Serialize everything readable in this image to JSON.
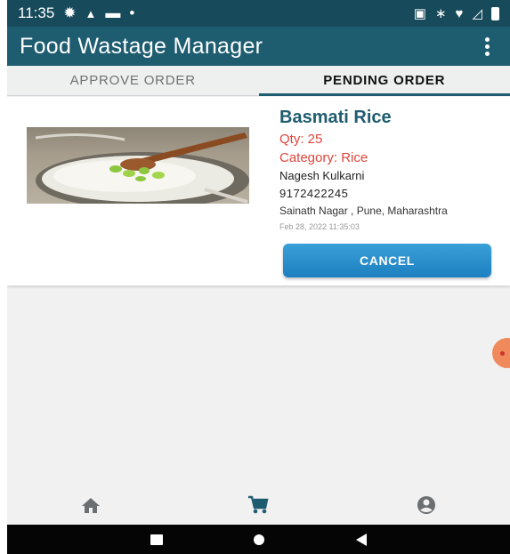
{
  "status_bar": {
    "time": "11:35",
    "icons": [
      "settings-icon",
      "warning-icon",
      "video-icon",
      "dot-icon",
      "nfc-icon",
      "bluetooth-icon",
      "wifi-icon",
      "signal-icon",
      "battery-icon"
    ]
  },
  "app_bar": {
    "title": "Food Wastage Manager",
    "menu_icon": "more-vert-icon"
  },
  "tabs": [
    {
      "label": "APPROVE ORDER",
      "selected": false
    },
    {
      "label": "PENDING ORDER",
      "selected": true
    }
  ],
  "order": {
    "name": "Basmati Rice",
    "qty": "Qty: 25",
    "category": "Category: Rice",
    "donor": "Nagesh Kulkarni",
    "phone": "9172422245",
    "address": "Sainath Nagar , Pune, Maharashtra",
    "timestamp": "Feb 28, 2022 11:35:03",
    "cancel_label": "CANCEL"
  },
  "bottom_nav": {
    "items": [
      {
        "icon": "home-icon",
        "active": false
      },
      {
        "icon": "cart-icon",
        "active": true
      },
      {
        "icon": "account-icon",
        "active": false
      }
    ]
  },
  "colors": {
    "status_bar": "#174a5a",
    "app_bar": "#1e5c70",
    "title_accent": "#1e5c70",
    "red_text": "#e2453b",
    "button_blue": "#1d7fc0",
    "fab": "#f08a5d"
  }
}
